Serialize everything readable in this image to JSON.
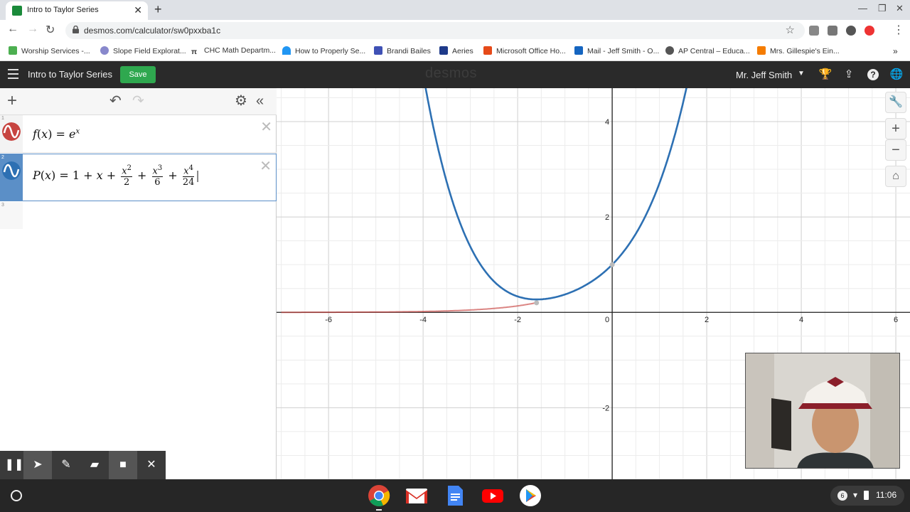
{
  "browser": {
    "tab_title": "Intro to Taylor Series",
    "url": "desmos.com/calculator/sw0pxxba1c",
    "bookmarks": [
      "Worship Services -...",
      "Slope Field Explorat...",
      "CHC Math Departm...",
      "How to Properly Se...",
      "Brandi Bailes",
      "Aeries",
      "Microsoft Office Ho...",
      "Mail - Jeff Smith - O...",
      "AP Central – Educa...",
      "Mrs. Gillespie's Ein..."
    ],
    "icons": [
      "back-icon",
      "forward-icon",
      "reload-icon",
      "lock-icon",
      "star-icon",
      "menu-dots-icon"
    ]
  },
  "desmos": {
    "graph_title": "Intro to Taylor Series",
    "save_label": "Save",
    "logo": "desmos",
    "user_name": "Mr. Jeff Smith",
    "expressions": [
      {
        "index": "1",
        "latex": "f(x)=e^x",
        "color": "#c74440"
      },
      {
        "index": "2",
        "latex": "P(x)=1+x+x^2/2+x^3/6+x^4/24",
        "color": "#2d70b3"
      },
      {
        "index": "3",
        "latex": ""
      }
    ]
  },
  "graph": {
    "x_ticks": [
      "-6",
      "-4",
      "-2",
      "0",
      "2",
      "4",
      "6"
    ],
    "y_ticks": [
      "4",
      "2",
      "-2"
    ],
    "grid": true
  },
  "chart_data": {
    "type": "line",
    "xlim": [
      -7.1,
      6.3
    ],
    "ylim": [
      -3.5,
      4.7
    ],
    "series": [
      {
        "name": "f(x)=e^x",
        "color": "#c74440",
        "x": [
          -7,
          -6,
          -5,
          -4,
          -3,
          -2,
          -1.6
        ],
        "y": [
          0.0009,
          0.0025,
          0.0067,
          0.0183,
          0.0498,
          0.1353,
          0.2019
        ]
      },
      {
        "name": "P(x)",
        "color": "#2d70b3",
        "x": [
          -4.05,
          -3.5,
          -3,
          -2.5,
          -2,
          -1.5,
          -1,
          -0.5,
          0,
          0.5,
          1,
          1.5,
          1.6
        ],
        "y": [
          4.57,
          2.54,
          1.38,
          0.7,
          0.33,
          0.23,
          0.38,
          0.61,
          1.0,
          1.65,
          2.71,
          4.44,
          4.91
        ]
      }
    ],
    "points": [
      {
        "x": -1.6,
        "y": 0.2
      },
      {
        "x": 0,
        "y": 1
      }
    ]
  },
  "recording_toolbar": {
    "icons": [
      "pause-icon",
      "pointer-icon",
      "pen-icon",
      "highlighter-icon",
      "camera-icon",
      "close-icon"
    ]
  },
  "shelf": {
    "apps": [
      "chrome",
      "gmail",
      "docs",
      "youtube",
      "play-store"
    ],
    "notification_count": "6",
    "time": "11:06"
  }
}
